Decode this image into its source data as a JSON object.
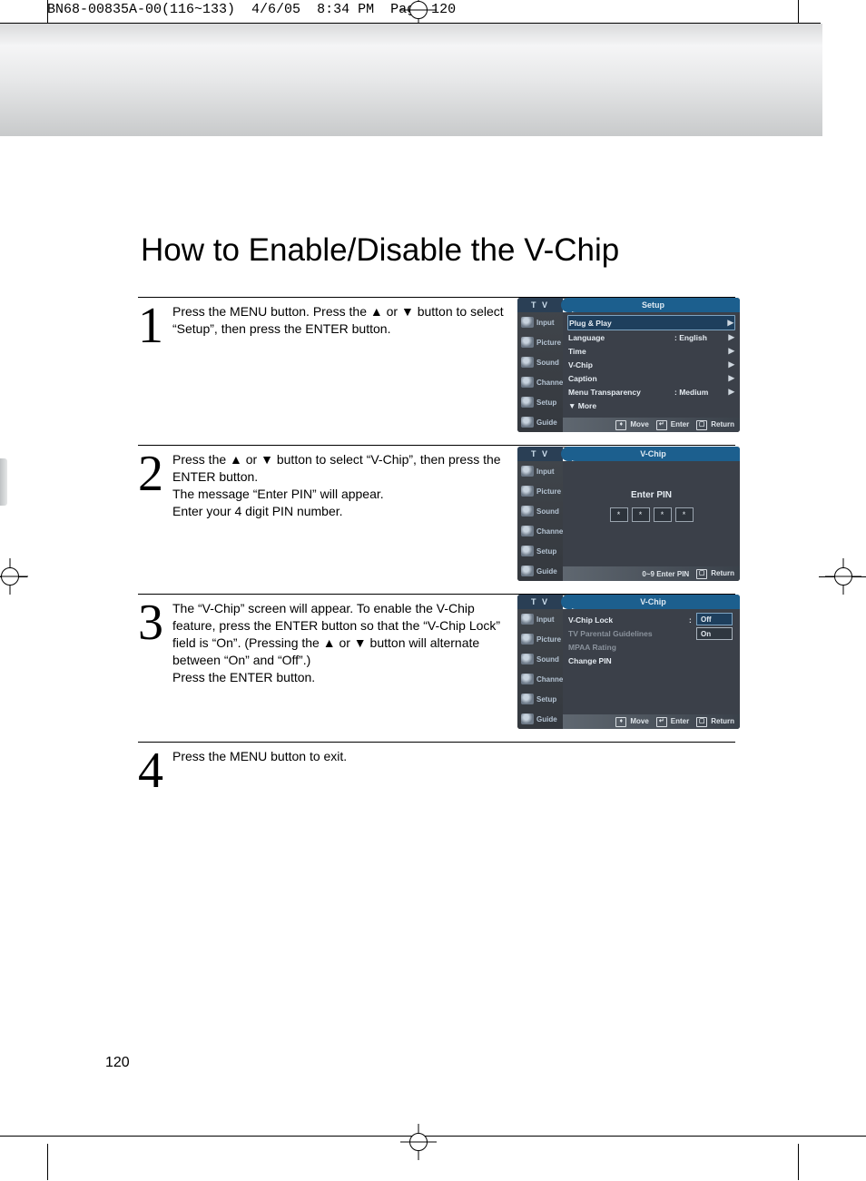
{
  "header": {
    "file": "BN68-00835A-00(116~133)",
    "date": "4/6/05",
    "time": "8:34 PM",
    "page": "Page 120"
  },
  "title": "How to Enable/Disable the V-Chip",
  "steps": {
    "s1": {
      "num": "1",
      "text": "Press the MENU button. Press the ▲ or ▼ button to select “Setup”, then press the ENTER button."
    },
    "s2": {
      "num": "2",
      "text": "Press the ▲ or ▼ button to select “V-Chip”, then press the ENTER button.\nThe message “Enter PIN” will appear.\nEnter your 4 digit PIN number."
    },
    "s3": {
      "num": "3",
      "text": "The “V-Chip” screen will appear. To enable the V-Chip feature, press the ENTER button so that the “V-Chip Lock” field is “On”. (Pressing the ▲ or ▼ button will alternate between “On” and “Off”.)\nPress the ENTER button."
    },
    "s4": {
      "num": "4",
      "text": "Press the MENU button to exit."
    }
  },
  "page_number": "120",
  "osd_side": [
    "Input",
    "Picture",
    "Sound",
    "Channel",
    "Setup",
    "Guide"
  ],
  "osd_tv": "T V",
  "osd1": {
    "title": "Setup",
    "rows": [
      {
        "label": "Plug & Play",
        "val": "",
        "arrow": "▶",
        "hl": true
      },
      {
        "label": "Language",
        "val": ": English",
        "arrow": "▶"
      },
      {
        "label": "Time",
        "val": "",
        "arrow": "▶"
      },
      {
        "label": "V-Chip",
        "val": "",
        "arrow": "▶"
      },
      {
        "label": "Caption",
        "val": "",
        "arrow": "▶"
      },
      {
        "label": "Menu Transparency",
        "val": ": Medium",
        "arrow": "▶"
      },
      {
        "label": "▼ More",
        "val": "",
        "arrow": ""
      }
    ],
    "foot": {
      "move": "Move",
      "enter": "Enter",
      "ret": "Return"
    }
  },
  "osd2": {
    "title": "V-Chip",
    "pin_label": "Enter PIN",
    "pin_char": "*",
    "foot": {
      "enterpin": "0~9 Enter PIN",
      "ret": "Return"
    }
  },
  "osd3": {
    "title": "V-Chip",
    "rows": [
      {
        "label": "V-Chip Lock",
        "val": ":",
        "dim": false
      },
      {
        "label": "TV Parental Guidelines",
        "val": "",
        "dim": true
      },
      {
        "label": "MPAA Rating",
        "val": "",
        "dim": true
      },
      {
        "label": "Change PIN",
        "val": "",
        "dim": false
      }
    ],
    "opts": {
      "off": "Off",
      "on": "On"
    },
    "foot": {
      "move": "Move",
      "enter": "Enter",
      "ret": "Return"
    }
  }
}
